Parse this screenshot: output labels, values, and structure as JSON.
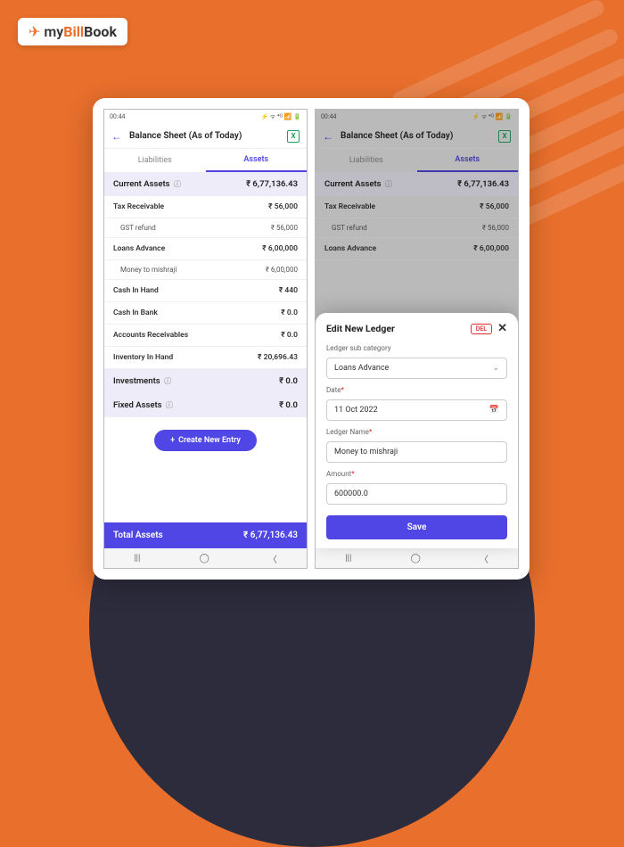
{
  "logo": {
    "my": "my",
    "bill": "Bill",
    "book": "Book"
  },
  "status": {
    "time": "00:44",
    "icons_left": "⛶ ⛶ ⬇",
    "icons_right": "⚡ ᯤ ⁴ᴳ 📶 🔋"
  },
  "header": {
    "title": "Balance Sheet (As of Today)"
  },
  "tabs": {
    "liabilities": "Liabilities",
    "assets": "Assets"
  },
  "sections": {
    "current_assets": {
      "label": "Current Assets",
      "value": "₹ 6,77,136.43"
    },
    "investments": {
      "label": "Investments",
      "value": "₹ 0.0"
    },
    "fixed_assets": {
      "label": "Fixed Assets",
      "value": "₹ 0.0"
    }
  },
  "rows": {
    "tax_receivable": {
      "label": "Tax Receivable",
      "value": "₹ 56,000"
    },
    "gst_refund": {
      "label": "GST refund",
      "value": "₹ 56,000"
    },
    "loans_advance": {
      "label": "Loans Advance",
      "value": "₹ 6,00,000"
    },
    "money_mishraji": {
      "label": "Money to mishraji",
      "value": "₹ 6,00,000"
    },
    "cash_in_hand": {
      "label": "Cash In Hand",
      "value": "₹ 440"
    },
    "cash_in_bank": {
      "label": "Cash In Bank",
      "value": "₹ 0.0"
    },
    "accounts_receivables": {
      "label": "Accounts Receivables",
      "value": "₹ 0.0"
    },
    "inventory_in_hand": {
      "label": "Inventory In Hand",
      "value": "₹ 20,696.43"
    }
  },
  "create_btn": "Create New Entry",
  "total": {
    "label": "Total Assets",
    "value": "₹ 6,77,136.43"
  },
  "sheet": {
    "title": "Edit New Ledger",
    "del": "DEL",
    "subcategory_label": "Ledger sub category",
    "subcategory_value": "Loans Advance",
    "date_label": "Date",
    "date_value": "11 Oct 2022",
    "name_label": "Ledger Name",
    "name_value": "Money to mishraji",
    "amount_label": "Amount",
    "amount_value": "600000.0",
    "save": "Save"
  },
  "nav": {
    "recent": "|||",
    "home": "◯",
    "back": "〈"
  }
}
